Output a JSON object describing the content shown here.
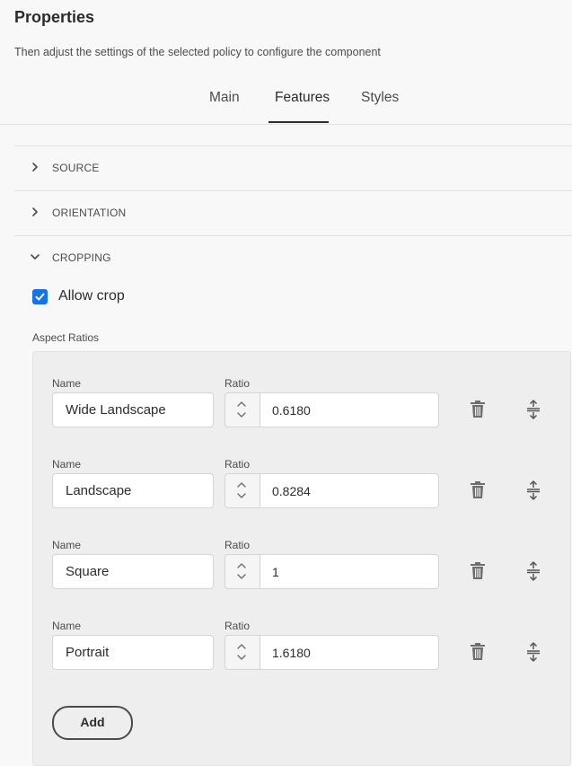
{
  "header": {
    "title": "Properties",
    "subtitle": "Then adjust the settings of the selected policy to configure the component"
  },
  "tabs": [
    {
      "label": "Main",
      "active": false
    },
    {
      "label": "Features",
      "active": true
    },
    {
      "label": "Styles",
      "active": false
    }
  ],
  "sections": {
    "source": {
      "label": "SOURCE",
      "expanded": false
    },
    "orientation": {
      "label": "ORIENTATION",
      "expanded": false
    },
    "cropping": {
      "label": "CROPPING",
      "expanded": true
    }
  },
  "cropping": {
    "allow_crop": {
      "label": "Allow crop",
      "checked": true
    },
    "aspect_ratios_label": "Aspect Ratios",
    "name_label": "Name",
    "ratio_label": "Ratio",
    "rows": [
      {
        "name": "Wide Landscape",
        "ratio": "0.6180"
      },
      {
        "name": "Landscape",
        "ratio": "0.8284"
      },
      {
        "name": "Square",
        "ratio": "1"
      },
      {
        "name": "Portrait",
        "ratio": "1.6180"
      }
    ],
    "add_label": "Add"
  },
  "colors": {
    "accent": "#1473e6",
    "background": "#f8f8f8",
    "panel": "#eeeeee",
    "text": "#2c2c2c"
  },
  "icons": [
    "chevron-right-icon",
    "chevron-down-icon",
    "checkmark-icon",
    "stepper-icon",
    "trash-icon",
    "drag-handle-icon"
  ]
}
